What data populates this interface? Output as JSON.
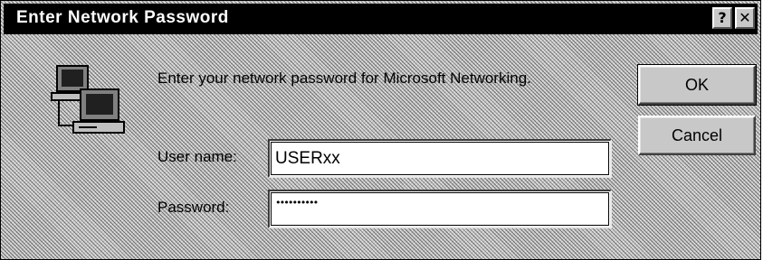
{
  "window": {
    "title": "Enter Network Password",
    "help_button": "?",
    "close_button": "✕"
  },
  "dialog": {
    "prompt": "Enter your network password for Microsoft Networking.",
    "username_label": "User name:",
    "password_label": "Password:",
    "username_value": "USERxx",
    "password_mask": "••••••••••"
  },
  "buttons": {
    "ok": "OK",
    "cancel": "Cancel"
  },
  "icons": {
    "network": "network-computers-icon"
  }
}
